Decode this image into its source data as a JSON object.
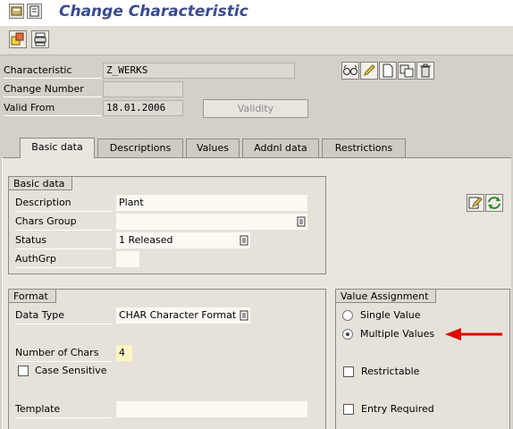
{
  "title": "Change Characteristic",
  "header": {
    "characteristic_label": "Characteristic",
    "characteristic_value": "Z_WERKS",
    "change_number_label": "Change Number",
    "change_number_value": "",
    "valid_from_label": "Valid From",
    "valid_from_value": "18.01.2006",
    "validity_button": "Validity"
  },
  "tabs": [
    "Basic data",
    "Descriptions",
    "Values",
    "Addnl data",
    "Restrictions"
  ],
  "basic_data": {
    "group_title": "Basic data",
    "description_label": "Description",
    "description_value": "Plant",
    "chars_group_label": "Chars Group",
    "chars_group_value": "",
    "status_label": "Status",
    "status_value": "1 Released",
    "authgrp_label": "AuthGrp",
    "authgrp_value": ""
  },
  "format": {
    "group_title": "Format",
    "data_type_label": "Data Type",
    "data_type_value": "CHAR Character Format",
    "num_chars_label": "Number of Chars",
    "num_chars_value": "4",
    "case_sensitive_label": "Case Sensitive",
    "template_label": "Template",
    "template_value": ""
  },
  "value_assignment": {
    "group_title": "Value Assignment",
    "single_value_label": "Single Value",
    "multiple_values_label": "Multiple Values",
    "selected": "Multiple Values",
    "restrictable_label": "Restrictable",
    "entry_required_label": "Entry Required"
  },
  "colors": {
    "title_text": "#3a4c8e",
    "annotation_arrow": "#e00000",
    "required_field": "#fff5c4"
  }
}
